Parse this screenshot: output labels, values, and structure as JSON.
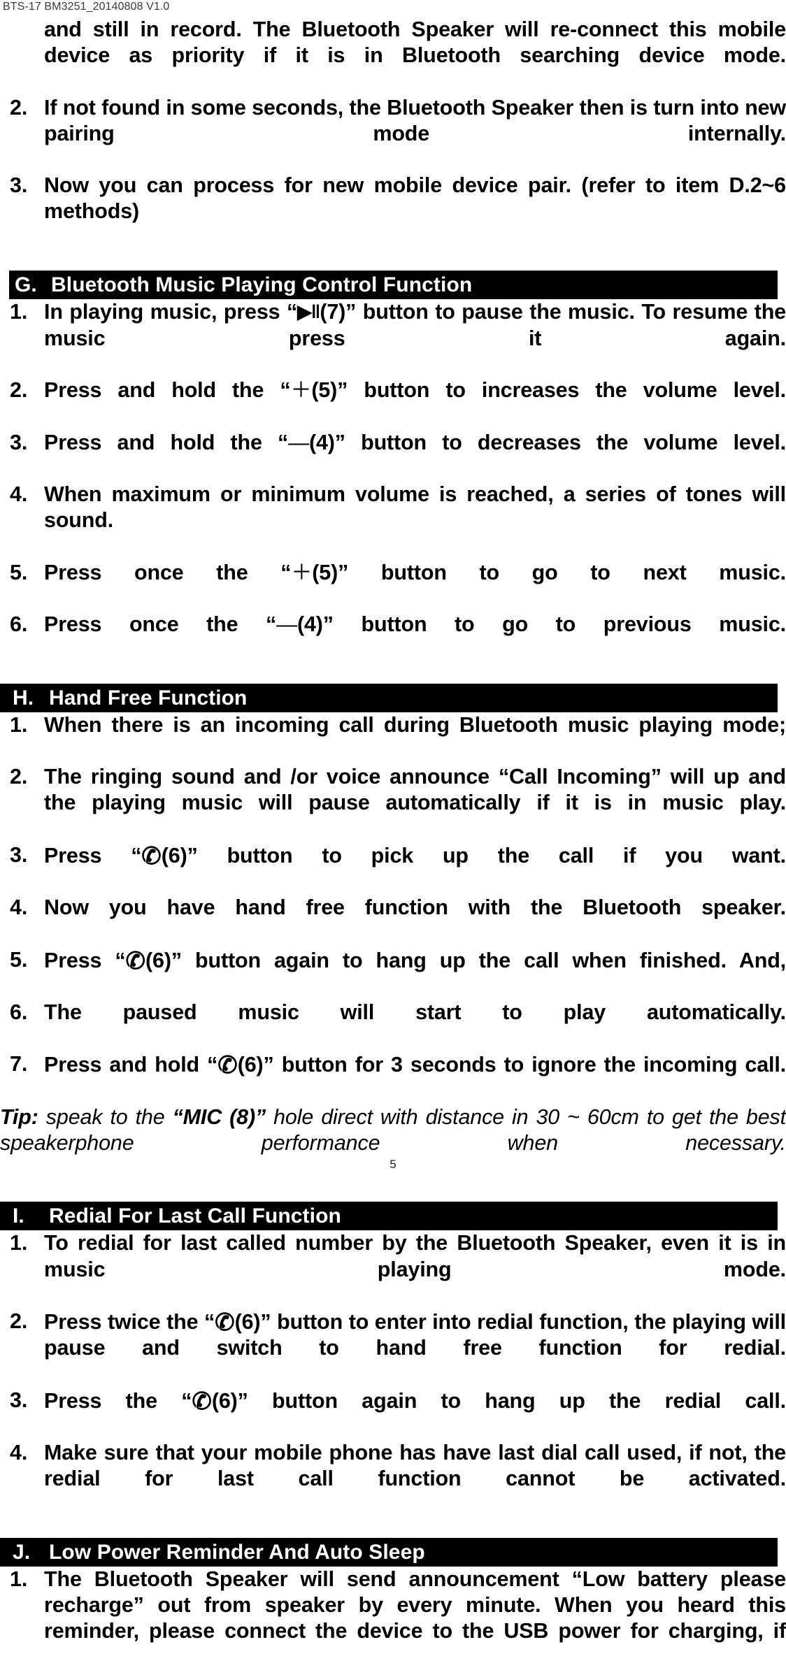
{
  "document": {
    "header": "BTS-17 BM3251_20140808 V1.0",
    "page_number": "5"
  },
  "continued_list": {
    "carryover_text": "and still in record. The Bluetooth Speaker will re-connect this mobile device as priority if it is in Bluetooth searching device mode.",
    "items": [
      {
        "marker": "2.",
        "text": "If not found in some seconds, the Bluetooth Speaker then is turn into new pairing mode internally."
      },
      {
        "marker": "3.",
        "text": "Now you can process for new mobile device pair. (refer to item D.2~6 methods)"
      }
    ]
  },
  "sections": [
    {
      "letter": "G.",
      "title": "Bluetooth Music Playing Control Function",
      "items": [
        {
          "marker": "1.",
          "pre": "In playing music, press “",
          "glyph": "▶‖",
          "glyph_name": "play-pause-icon",
          "ref": "(7)”",
          "post": " button to pause the music. To resume the music press it again."
        },
        {
          "marker": "2.",
          "pre": "Press and hold the “",
          "glyph": "＋",
          "glyph_name": "plus-icon",
          "ref": "(5)”",
          "post": " button to increases the volume level."
        },
        {
          "marker": "3.",
          "pre": "Press and hold the “",
          "glyph": "―",
          "glyph_name": "minus-icon",
          "ref": "(4)”",
          "post": " button to decreases the volume level."
        },
        {
          "marker": "4.",
          "pre": "When maximum or minimum volume is reached, a series of tones will sound.",
          "glyph": "",
          "glyph_name": "",
          "ref": "",
          "post": ""
        },
        {
          "marker": "5.",
          "pre": "Press once the “",
          "glyph": "＋",
          "glyph_name": "plus-icon",
          "ref": "(5)”",
          "post": " button to go to next music."
        },
        {
          "marker": "6.",
          "pre": "Press once the “",
          "glyph": "―",
          "glyph_name": "minus-icon",
          "ref": "(4)”",
          "post": " button to go to previous music."
        }
      ]
    },
    {
      "letter": "H.",
      "title": "Hand Free Function",
      "items": [
        {
          "marker": "1.",
          "pre": "When there is an incoming call during Bluetooth music playing mode;",
          "glyph": "",
          "glyph_name": "",
          "ref": "",
          "post": ""
        },
        {
          "marker": "2.",
          "pre": "The ringing sound and /or voice announce ",
          "strong": "“Call Incoming”",
          "glyph": "",
          "glyph_name": "",
          "ref": "",
          "post": " will up and the playing music will pause automatically if it is in music play."
        },
        {
          "marker": "3.",
          "pre": "Press “",
          "glyph": "✆",
          "glyph_name": "phone-handset-icon",
          "ref": "(6)”",
          "post": " button to pick up the call if you want."
        },
        {
          "marker": "4.",
          "pre": "Now you have hand free function with the Bluetooth speaker.",
          "glyph": "",
          "glyph_name": "",
          "ref": "",
          "post": ""
        },
        {
          "marker": "5.",
          "pre": "Press “",
          "glyph": "✆",
          "glyph_name": "phone-handset-icon",
          "ref": "(6)”",
          "post": " button again to hang up the call when finished. And,"
        },
        {
          "marker": "6.",
          "pre": "The paused music will start to play automatically.",
          "glyph": "",
          "glyph_name": "",
          "ref": "",
          "post": ""
        },
        {
          "marker": "7.",
          "pre": "Press and hold “",
          "glyph": "✆",
          "glyph_name": "phone-handset-icon",
          "ref": "(6)”",
          "post": " button for 3 seconds to ignore the incoming call."
        }
      ],
      "tip": {
        "label": "Tip:",
        "part1": " speak to the ",
        "strong": "“MIC (8)”",
        "part2": " hole direct with distance in 30 ~ 60cm to get the best speakerphone performance when necessary."
      }
    },
    {
      "letter": "I.",
      "title": "Redial For Last Call Function",
      "items": [
        {
          "marker": "1.",
          "pre": "To redial for last called number by the Bluetooth Speaker, even it is in music playing mode.",
          "glyph": "",
          "glyph_name": "",
          "ref": "",
          "post": ""
        },
        {
          "marker": "2.",
          "pre": "Press twice the “",
          "glyph": "✆",
          "glyph_name": "phone-handset-icon",
          "ref": "(6)”",
          "post": " button to enter into redial function, the playing will pause and switch to hand free function for redial."
        },
        {
          "marker": "3.",
          "pre": "Press the “",
          "glyph": "✆",
          "glyph_name": "phone-handset-icon",
          "ref": "(6)”",
          "post": " button again to hang up the redial call."
        },
        {
          "marker": "4.",
          "pre": "Make sure that your mobile phone has have last dial call used, if not, the redial for last call function cannot be activated.",
          "glyph": "",
          "glyph_name": "",
          "ref": "",
          "post": ""
        }
      ]
    },
    {
      "letter": "J.",
      "title": "Low Power Reminder And Auto Sleep",
      "items": [
        {
          "marker": "1.",
          "pre": "The Bluetooth Speaker will send announcement ",
          "strong": "“Low battery please recharge”",
          "glyph": "",
          "glyph_name": "",
          "ref": "",
          "post": " out from speaker by every minute. When you heard this reminder, please connect the device to the USB power for charging, if"
        }
      ]
    }
  ]
}
